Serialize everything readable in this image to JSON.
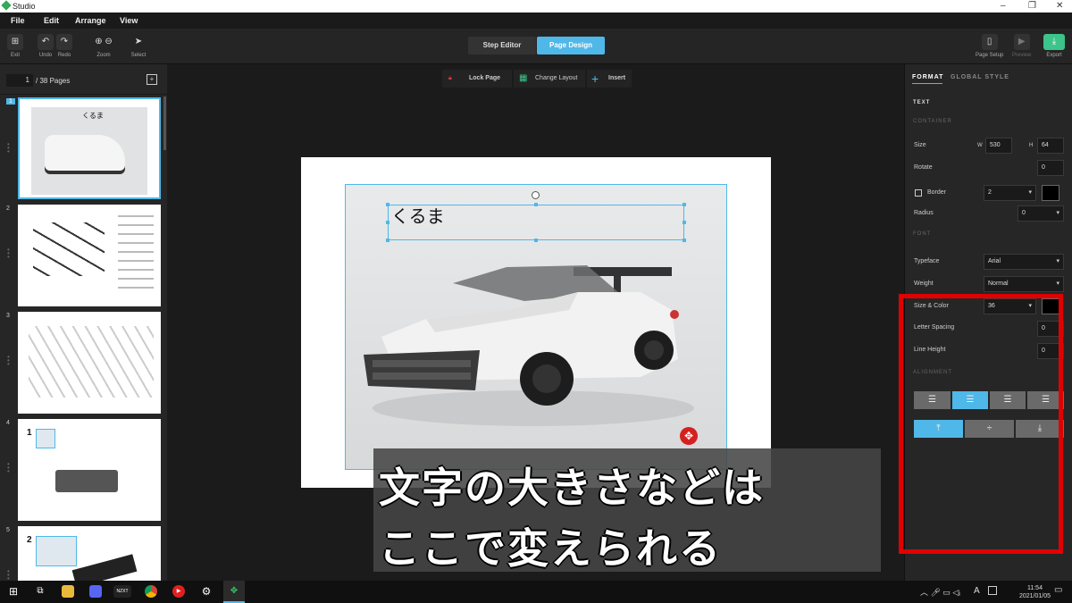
{
  "window": {
    "title": "Studio",
    "controls": [
      "–",
      "❐",
      "✕"
    ]
  },
  "menu": [
    "File",
    "Edit",
    "Arrange",
    "View"
  ],
  "toolbar": {
    "exit": "Exit",
    "undo": "Undo",
    "redo": "Redo",
    "zoom": "Zoom",
    "select": "Select",
    "step_editor": "Step Editor",
    "page_design": "Page Design",
    "page_setup": "Page Setup",
    "preview": "Preview",
    "export": "Export"
  },
  "pages": {
    "current": "1",
    "total_label": "/ 38 Pages",
    "thumbs": [
      {
        "num": "1",
        "title": "くるま"
      },
      {
        "num": "2"
      },
      {
        "num": "3"
      },
      {
        "num": "4",
        "step": "1"
      },
      {
        "num": "5",
        "step": "2"
      }
    ]
  },
  "canvas_toolbar": {
    "lock": "Lock Page",
    "layout": "Change Layout",
    "insert": "Insert"
  },
  "canvas": {
    "text": "くるま"
  },
  "caption": {
    "line1": "文字の大きさなどは",
    "line2": "ここで変えられる"
  },
  "format": {
    "tab_format": "FORMAT",
    "tab_global": "GLOBAL STYLE",
    "heading": "TEXT",
    "container_label": "CONTAINER",
    "size_label": "Size",
    "w_label": "W",
    "w": "530",
    "h_label": "H",
    "h": "64",
    "rotate_label": "Rotate",
    "rotate": "0",
    "border_label": "Border",
    "border": "2",
    "radius_label": "Radius",
    "radius": "0",
    "font_label": "FONT",
    "typeface_label": "Typeface",
    "typeface": "Arial",
    "weight_label": "Weight",
    "weight": "Normal",
    "size_color_label": "Size & Color",
    "font_size": "36",
    "letter_spacing_label": "Letter Spacing",
    "letter_spacing": "0",
    "line_height_label": "Line Height",
    "line_height": "0",
    "alignment_label": "ALIGNMENT"
  },
  "taskbar": {
    "time": "11:54",
    "date": "2021/01/05",
    "nzxt": "NZXT",
    "ime": "A"
  },
  "colors": {
    "accent": "#4fb8e8",
    "highlight": "#e00000"
  }
}
